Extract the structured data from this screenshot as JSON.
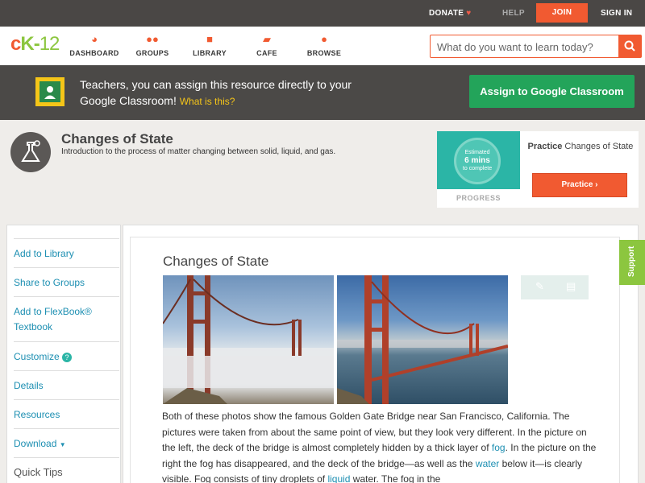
{
  "topbar": {
    "donate": "DONATE",
    "help": "HELP",
    "join": "JOIN",
    "signin": "SIGN IN"
  },
  "logo": {
    "c": "c",
    "k": "K",
    "dash": "-",
    "num": "12"
  },
  "nav": [
    {
      "label": "DASHBOARD",
      "icon": "dashboard-icon"
    },
    {
      "label": "GROUPS",
      "icon": "groups-icon"
    },
    {
      "label": "LIBRARY",
      "icon": "library-icon"
    },
    {
      "label": "CAFE",
      "icon": "cafe-icon"
    },
    {
      "label": "BROWSE",
      "icon": "browse-icon"
    }
  ],
  "search": {
    "placeholder": "What do you want to learn today?"
  },
  "classroom": {
    "text": "Teachers, you can assign this resource directly to your Google Classroom!",
    "what": "What is this?",
    "button": "Assign to Google Classroom"
  },
  "concept": {
    "title": "Changes of State",
    "subtitle": "Introduction to the process of matter changing between solid, liquid, and gas."
  },
  "practice": {
    "estimated": "Estimated",
    "mins": "6 mins",
    "to_complete": "to complete",
    "progress_label": "PROGRESS",
    "title_bold": "Practice",
    "title_rest": "Changes of State",
    "button": "Practice"
  },
  "side": {
    "items": [
      "Add to Library",
      "Share to Groups",
      "Add to FlexBook® Textbook",
      "Customize",
      "Details",
      "Resources",
      "Download",
      "Quick Tips"
    ]
  },
  "content": {
    "title": "Changes of State",
    "para_1": "Both of these photos show the famous Golden Gate Bridge near San Francisco, California. The pictures were taken from about the same point of view, but they look very different. In the picture on the left, the deck of the bridge is almost completely hidden by a thick layer of ",
    "link_fog": "fog",
    "para_2": ". In the picture on the right the fog has disappeared, and the deck of the bridge—as well as the ",
    "link_water": "water",
    "para_3": " below it—is clearly visible. Fog consists of tiny droplets of ",
    "link_liquid": "liquid",
    "para_4": " water. The fog in the"
  },
  "support": "Support",
  "colors": {
    "accent": "#f15a31",
    "green": "#8cc63f",
    "teal": "#2bb5a6",
    "link": "#1d8fb2",
    "classroom_green": "#23a45a"
  }
}
